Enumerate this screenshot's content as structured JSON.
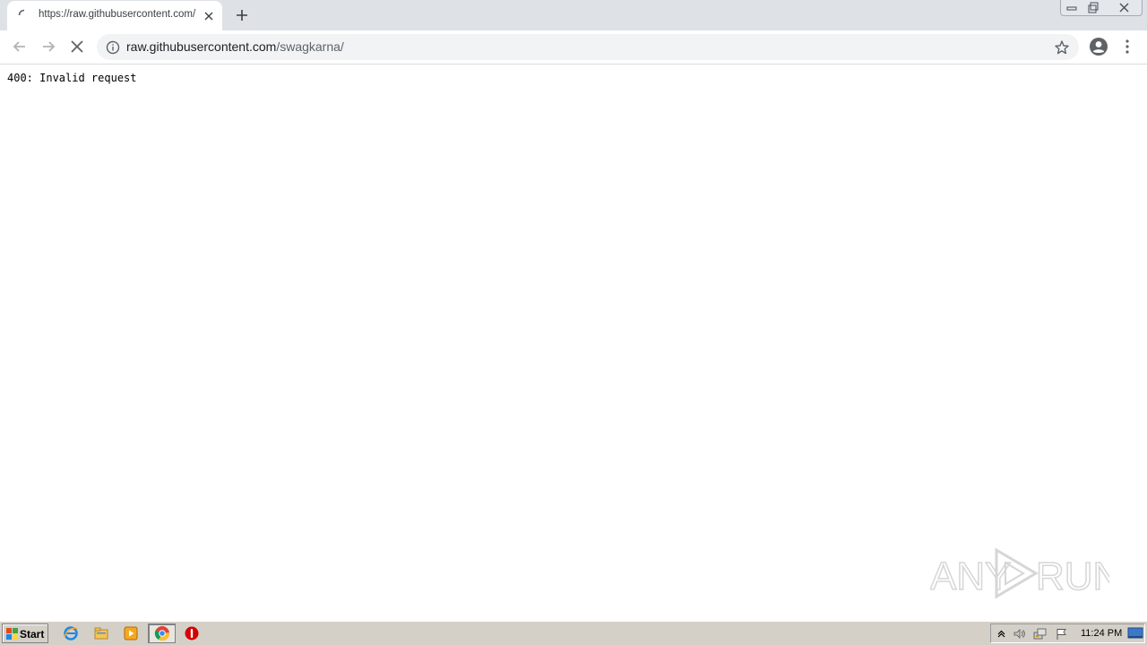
{
  "browser": {
    "tab": {
      "title": "https://raw.githubusercontent.com/",
      "loading": true
    },
    "address_bar": {
      "host": "raw.githubusercontent.com",
      "path": "/swagkarna/"
    }
  },
  "page": {
    "body_text": "400: Invalid request"
  },
  "watermark": {
    "text_left": "ANY",
    "text_right": "RUN"
  },
  "taskbar": {
    "start_label": "Start",
    "clock": "11:24 PM",
    "pinned_icons": [
      "internet-explorer-icon",
      "file-explorer-icon",
      "media-player-icon",
      "chrome-icon",
      "stop-sign-icon"
    ]
  },
  "colors": {
    "tabstrip_bg": "#dee1e6",
    "omnibox_bg": "#f1f3f4",
    "taskbar_bg": "#d4d0c8"
  }
}
